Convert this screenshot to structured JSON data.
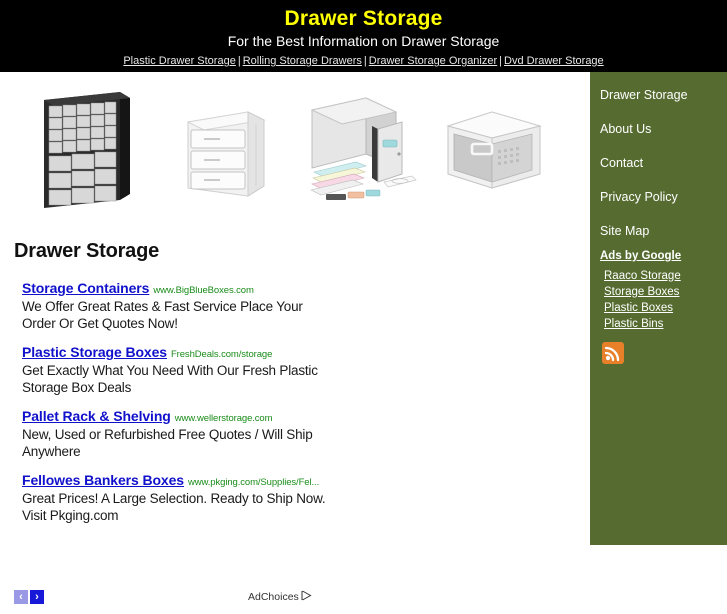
{
  "header": {
    "title": "Drawer Storage",
    "tagline": "For the Best Information on Drawer Storage",
    "nav": [
      {
        "label": "Plastic Drawer Storage"
      },
      {
        "label": "Rolling Storage Drawers"
      },
      {
        "label": "Drawer Storage Organizer"
      },
      {
        "label": "Dvd Drawer Storage"
      }
    ],
    "separator": "|",
    "title_color": "#ffff00",
    "background_color": "#000000"
  },
  "main": {
    "page_title": "Drawer Storage",
    "products": [
      {
        "name": "black-multi-drawer-parts-cabinet"
      },
      {
        "name": "clear-three-drawer-plastic-unit"
      },
      {
        "name": "grey-filing-drawer-box-with-cards"
      },
      {
        "name": "white-grey-modular-storage-drawer"
      }
    ],
    "ads": [
      {
        "title": "Storage Containers",
        "url": "www.BigBlueBoxes.com",
        "description": "We Offer Great Rates & Fast Service Place Your Order Or Get Quotes Now!"
      },
      {
        "title": "Plastic Storage Boxes",
        "url": "FreshDeals.com/storage",
        "description": "Get Exactly What You Need With Our Fresh Plastic Storage Box Deals"
      },
      {
        "title": "Pallet Rack & Shelving",
        "url": "www.wellerstorage.com",
        "description": "New, Used or Refurbished Free Quotes / Will Ship Anywhere"
      },
      {
        "title": "Fellowes Bankers Boxes",
        "url": "www.pkging.com/Supplies/Fel...",
        "description": "Great Prices! A Large Selection. Ready to Ship Now. Visit Pkging.com"
      }
    ],
    "ad_footer": {
      "prev_label": "‹",
      "next_label": "›",
      "adchoices_label": "AdChoices"
    },
    "ad_link_color": "#1111cc",
    "ad_url_color": "#1a8c1a"
  },
  "sidebar": {
    "background_color": "#566b30",
    "items": [
      {
        "label": "Drawer Storage"
      },
      {
        "label": "About Us"
      },
      {
        "label": "Contact"
      },
      {
        "label": "Privacy Policy"
      },
      {
        "label": "Site Map"
      }
    ],
    "ads_heading": "Ads by Google",
    "ad_links": [
      {
        "label": "Raaco Storage"
      },
      {
        "label": "Storage Boxes"
      },
      {
        "label": "Plastic Boxes"
      },
      {
        "label": "Plastic Bins"
      }
    ],
    "rss_icon": "rss-feed-icon",
    "rss_color": "#e8802a"
  }
}
